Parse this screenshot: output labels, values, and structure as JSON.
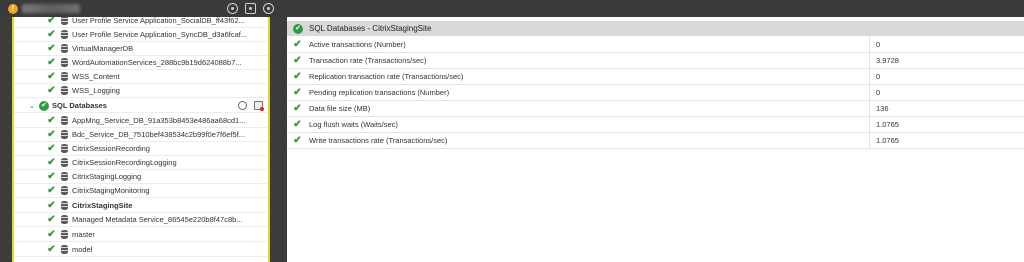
{
  "toolbar": {
    "warning_icon": "warning-icon",
    "icons": [
      "clock-icon",
      "copy-icon",
      "settings-icon"
    ]
  },
  "tree": {
    "items_top": [
      {
        "label": "User Profile Service Application_SocialDB_ff43f62...",
        "icon": "database-icon"
      },
      {
        "label": "User Profile Service Application_SyncDB_d3a6fcaf...",
        "icon": "database-icon"
      },
      {
        "label": "VirtualManagerDB",
        "icon": "database-icon"
      },
      {
        "label": "WordAutomationServices_288bc9b19d624088b7...",
        "icon": "database-icon"
      },
      {
        "label": "WSS_Content",
        "icon": "database-icon"
      },
      {
        "label": "WSS_Logging",
        "icon": "database-icon"
      }
    ],
    "group": {
      "label": "SQL Databases"
    },
    "items": [
      {
        "label": "AppMng_Service_DB_91a353b8453e486aa68cd1..."
      },
      {
        "label": "Bdc_Service_DB_7510bef438534c2b99f0e7f6ef5f..."
      },
      {
        "label": "CitrixSessionRecording"
      },
      {
        "label": "CitrixSessionRecordingLogging"
      },
      {
        "label": "CitrixStagingLogging"
      },
      {
        "label": "CitrixStagingMonitoring"
      },
      {
        "label": "CitrixStagingSite",
        "selected": true
      },
      {
        "label": "Managed Metadata Service_86545e220b8f47c8b..."
      },
      {
        "label": "master"
      },
      {
        "label": "model"
      }
    ]
  },
  "panel": {
    "title": "SQL Databases - CitrixStagingSite",
    "metrics": [
      {
        "name": "Active transactions (Number)",
        "value": "0"
      },
      {
        "name": "Transaction rate (Transactions/sec)",
        "value": "3.9728"
      },
      {
        "name": "Replication transaction rate (Transactions/sec)",
        "value": "0"
      },
      {
        "name": "Pending replication transactions (Number)",
        "value": "0"
      },
      {
        "name": "Data file size (MB)",
        "value": "136"
      },
      {
        "name": "Log flush waits (Waits/sec)",
        "value": "1.0765"
      },
      {
        "name": "Write transactions rate (Transactions/sec)",
        "value": "1.0765"
      }
    ]
  },
  "colors": {
    "ok": "#2e9e3c",
    "accent_border": "#e8d42a",
    "header_bg": "#d9d9d9",
    "dark_bg": "#3c3c3c"
  }
}
